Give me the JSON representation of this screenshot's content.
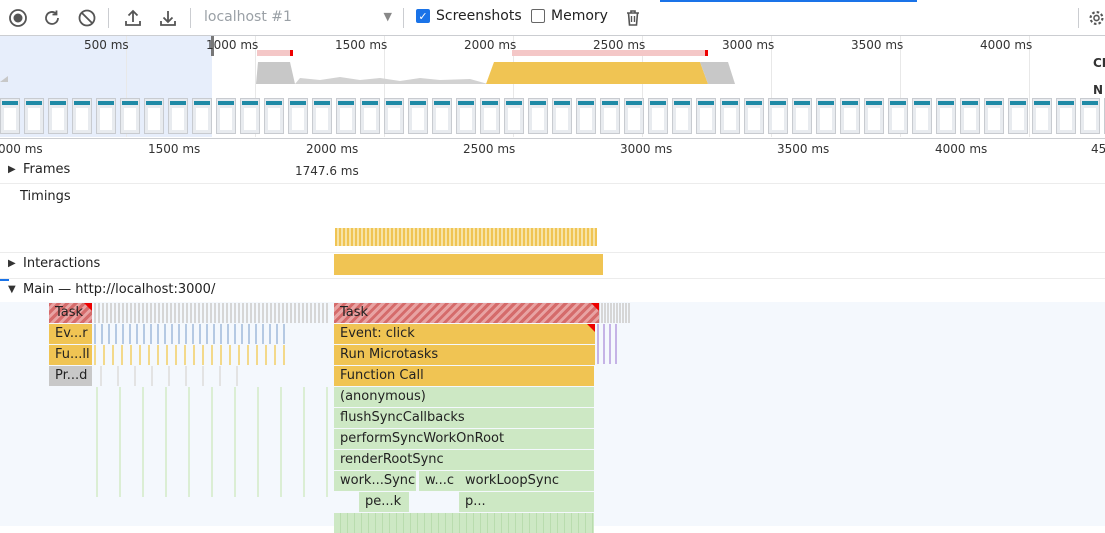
{
  "toolbar": {
    "record_label": "Record",
    "reload_label": "Start profiling and reload page",
    "clear_label": "Clear",
    "upload_label": "Load profile",
    "download_label": "Save profile",
    "target_placeholder": "localhost #1",
    "screenshots_label": "Screenshots",
    "screenshots_checked": true,
    "memory_label": "Memory",
    "memory_checked": false,
    "delete_label": "Delete",
    "settings_label": "Capture settings"
  },
  "overview": {
    "ticks": [
      "500 ms",
      "1000 ms",
      "1500 ms",
      "2000 ms",
      "2500 ms",
      "3000 ms",
      "3500 ms",
      "4000 ms"
    ],
    "side_labels": [
      "CPU",
      "NET"
    ],
    "side_labels_visible": [
      "CI",
      "N"
    ]
  },
  "ruler": {
    "ticks": [
      "000 ms",
      "1500 ms",
      "2000 ms",
      "2500 ms",
      "3000 ms",
      "3500 ms",
      "4000 ms",
      "45"
    ]
  },
  "tracks": {
    "frames": {
      "label": "Frames",
      "value": "1747.6 ms"
    },
    "timings": {
      "label": "Timings"
    },
    "interactions": {
      "label": "Interactions"
    },
    "main": {
      "label": "Main — http://localhost:3000/"
    }
  },
  "flame": {
    "left_col": [
      "Task",
      "Ev...r",
      "Fu...ll",
      "Pr...d"
    ],
    "center_col": [
      "Task",
      "Event: click",
      "Run Microtasks",
      "Function Call",
      "(anonymous)",
      "flushSyncCallbacks",
      "performSyncWorkOnRoot",
      "renderRootSync",
      "work...Sync",
      "w...c",
      "workLoopSync",
      "pe...k",
      "p..."
    ]
  },
  "colors": {
    "task_red": "#d56b6b",
    "scripting_yellow": "#f0c453",
    "rendering_green": "#cde8c4",
    "accent_blue": "#1a73e8"
  }
}
